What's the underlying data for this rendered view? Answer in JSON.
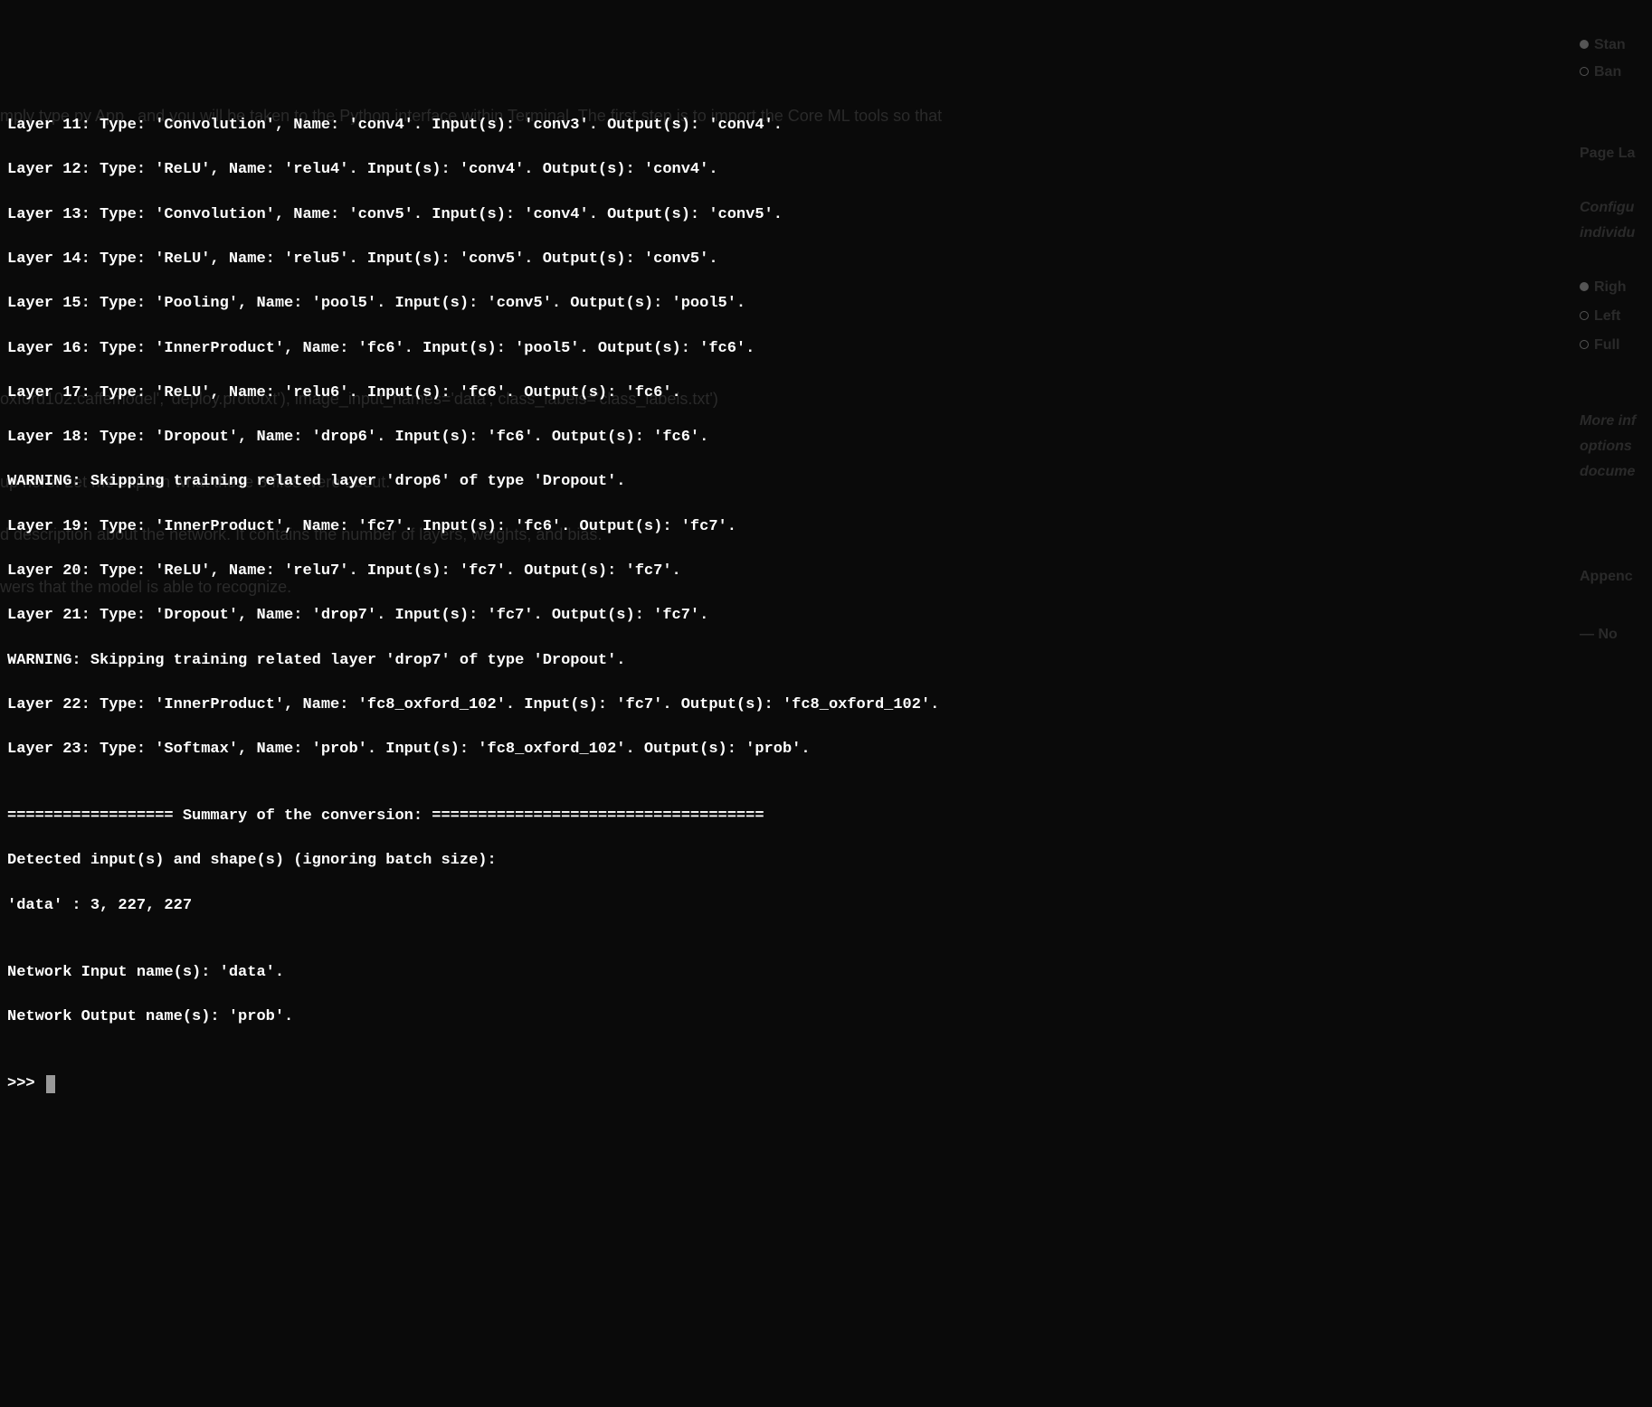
{
  "terminal": {
    "lines": [
      "Layer 11: Type: 'Convolution', Name: 'conv4'. Input(s): 'conv3'. Output(s): 'conv4'.",
      "Layer 12: Type: 'ReLU', Name: 'relu4'. Input(s): 'conv4'. Output(s): 'conv4'.",
      "Layer 13: Type: 'Convolution', Name: 'conv5'. Input(s): 'conv4'. Output(s): 'conv5'.",
      "Layer 14: Type: 'ReLU', Name: 'relu5'. Input(s): 'conv5'. Output(s): 'conv5'.",
      "Layer 15: Type: 'Pooling', Name: 'pool5'. Input(s): 'conv5'. Output(s): 'pool5'.",
      "Layer 16: Type: 'InnerProduct', Name: 'fc6'. Input(s): 'pool5'. Output(s): 'fc6'.",
      "Layer 17: Type: 'ReLU', Name: 'relu6'. Input(s): 'fc6'. Output(s): 'fc6'.",
      "Layer 18: Type: 'Dropout', Name: 'drop6'. Input(s): 'fc6'. Output(s): 'fc6'.",
      "WARNING: Skipping training related layer 'drop6' of type 'Dropout'.",
      "Layer 19: Type: 'InnerProduct', Name: 'fc7'. Input(s): 'fc6'. Output(s): 'fc7'.",
      "Layer 20: Type: 'ReLU', Name: 'relu7'. Input(s): 'fc7'. Output(s): 'fc7'.",
      "Layer 21: Type: 'Dropout', Name: 'drop7'. Input(s): 'fc7'. Output(s): 'fc7'.",
      "WARNING: Skipping training related layer 'drop7' of type 'Dropout'.",
      "Layer 22: Type: 'InnerProduct', Name: 'fc8_oxford_102'. Input(s): 'fc7'. Output(s): 'fc8_oxford_102'.",
      "Layer 23: Type: 'Softmax', Name: 'prob'. Input(s): 'fc8_oxford_102'. Output(s): 'prob'.",
      "",
      "================== Summary of the conversion: ====================================",
      "Detected input(s) and shape(s) (ignoring batch size):",
      "'data' : 3, 227, 227",
      "",
      "Network Input name(s): 'data'.",
      "Network Output name(s): 'prob'.",
      ""
    ],
    "prompt": ">>> "
  },
  "background": {
    "text1": "mply type py App , and you will be taken to the Python interface within Terminal. The first step is to import the Core ML tools so that",
    "text2": "Layer 21: oType:in'Dropouty,pName:t'drop7'. Input(s): 'fc7'. Output(s): 'fc7'.",
    "text3": "oxford102.caffemodel', 'deploy.prototxt'), image_input_names='data', class_labels='class_labels.txt')",
    "text4": "up here. Let me explain what these 3 files were about.",
    "text5": "d description about the network. It contains the number of layers, weights, and bias.",
    "text6": "wers that the model is able to recognize."
  },
  "right_panel": {
    "item1": "Stan",
    "item2": "Ban",
    "heading1": "Page La",
    "desc1": "Configu",
    "desc2": "individu",
    "item3": "Righ",
    "item4": "Left",
    "item5": "Full",
    "desc3": "More inf",
    "desc4": "options",
    "desc5": "docume",
    "heading2": "Appenc",
    "item6": "— No"
  }
}
